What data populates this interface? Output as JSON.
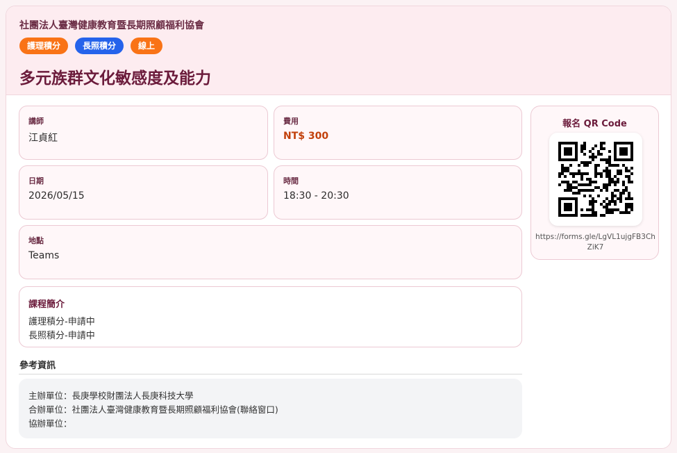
{
  "header": {
    "organization": "社團法人臺灣健康教育暨長期照顧福利協會",
    "tags": [
      {
        "label": "護理積分",
        "color": "#f97316"
      },
      {
        "label": "長照積分",
        "color": "#2563eb"
      },
      {
        "label": "線上",
        "color": "#f97316"
      }
    ],
    "title": "多元族群文化敏感度及能力"
  },
  "details": {
    "instructor": {
      "label": "講師",
      "value": "江貞紅"
    },
    "fee": {
      "label": "費用",
      "value": "NT$ 300"
    },
    "date": {
      "label": "日期",
      "value": "2026/05/15"
    },
    "time": {
      "label": "時間",
      "value": "18:30 - 20:30"
    },
    "location": {
      "label": "地點",
      "value": "Teams"
    }
  },
  "intro": {
    "heading": "課程簡介",
    "lines": [
      "護理積分-申請中",
      "長照積分-申請中"
    ]
  },
  "reference": {
    "heading": "參考資訊",
    "lines": [
      "主辦單位：長庚學校財團法人長庚科技大學",
      "合辦單位：社團法人臺灣健康教育暨長期照顧福利協會(聯絡窗口)",
      "協辦單位："
    ]
  },
  "qr": {
    "title": "報名 QR Code",
    "url": "https://forms.gle/LgVL1ujgFB3ChZiK7"
  }
}
